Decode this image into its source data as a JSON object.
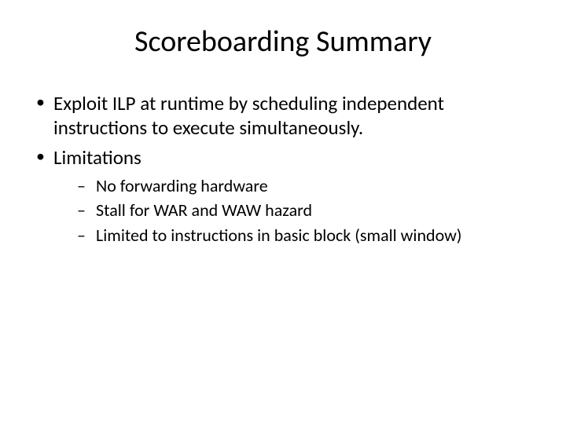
{
  "title": "Scoreboarding Summary",
  "bullets": [
    {
      "text": "Exploit ILP at runtime by scheduling independent instructions to execute simultaneously."
    },
    {
      "text": "Limitations",
      "sub": [
        "No forwarding hardware",
        "Stall for WAR and WAW hazard",
        "Limited to instructions in basic block (small window)"
      ]
    }
  ]
}
